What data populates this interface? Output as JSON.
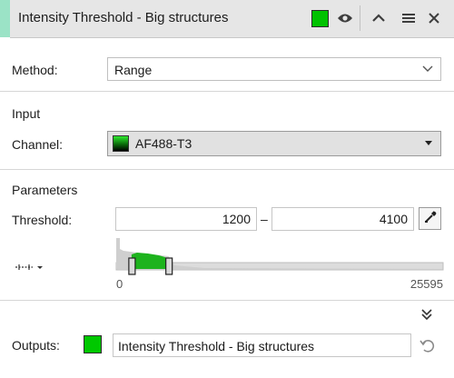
{
  "header": {
    "title": "Intensity Threshold - Big structures",
    "color": "#00c200",
    "icons": [
      "eye-icon",
      "chevron-up-icon",
      "menu-icon",
      "close-icon"
    ]
  },
  "method": {
    "label": "Method:",
    "value": "Range"
  },
  "input": {
    "section_title": "Input",
    "channel_label": "Channel:",
    "channel_value": "AF488-T3"
  },
  "parameters": {
    "section_title": "Parameters",
    "threshold_label": "Threshold:",
    "low": "1200",
    "separator": "–",
    "high": "4100",
    "histogram": {
      "min_label": "0",
      "max_label": "25595",
      "range_min": 0,
      "range_max": 25595,
      "low_value": 1200,
      "high_value": 4100,
      "selected_color": "#1db31d"
    }
  },
  "outputs": {
    "label": "Outputs:",
    "color": "#00c800",
    "name": "Intensity Threshold - Big structures"
  }
}
